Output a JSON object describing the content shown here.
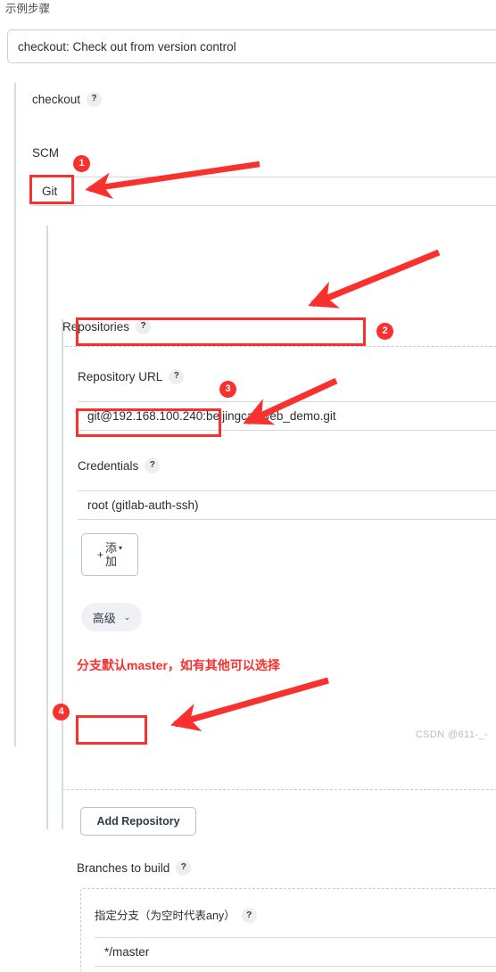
{
  "top_label": "示例步骤",
  "step_select": {
    "value": "checkout: Check out from version control"
  },
  "section": {
    "title": "checkout",
    "help": "?"
  },
  "scm": {
    "label": "SCM",
    "value": "Git"
  },
  "repositories": {
    "label": "Repositories",
    "help": "?",
    "repository_url": {
      "label": "Repository URL",
      "help": "?",
      "value": "git@192.168.100.240:beijingcar/web_demo.git"
    },
    "credentials": {
      "label": "Credentials",
      "help": "?",
      "value": "root (gitlab-auth-ssh)"
    },
    "add_button": {
      "plus": "+",
      "line1": "添",
      "line2": "加",
      "caret": "▾"
    },
    "advanced_button": {
      "label": "高级",
      "caret": "⌄"
    }
  },
  "add_repository_button": {
    "label": "Add Repository"
  },
  "branches": {
    "label": "Branches to build",
    "help": "?",
    "annotation": "分支默认master，如有其他可以选择",
    "specifier_label": "指定分支（为空时代表any）",
    "specifier_help": "?",
    "specifier_value": "*/master"
  },
  "badges": {
    "one": "1",
    "two": "2",
    "three": "3",
    "four": "4"
  },
  "watermark": "CSDN @611-_-",
  "colors": {
    "annotation_red": "#f8302e",
    "field_border": "#d3dade",
    "section_bar": "#d5dbe0",
    "pill_bg": "#f0f1f4"
  }
}
